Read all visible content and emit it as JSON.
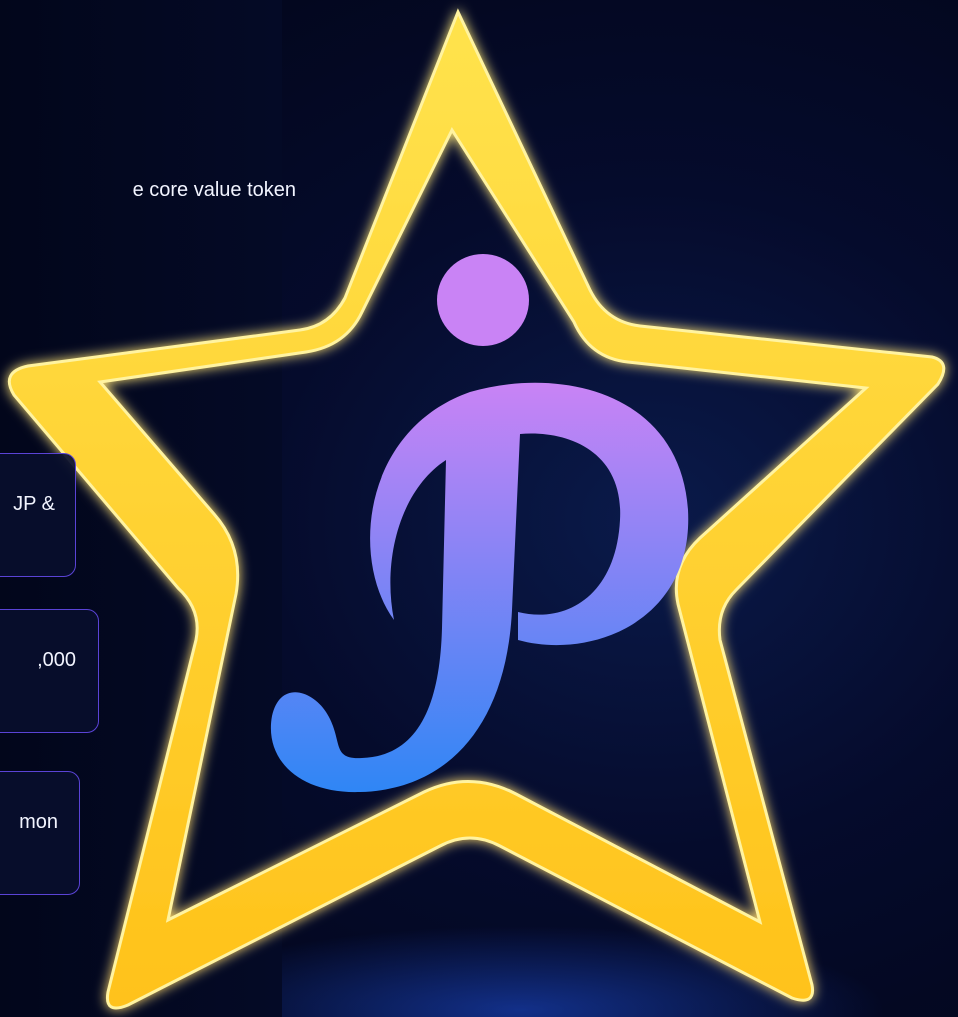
{
  "intro": {
    "text_fragment": "e core value token"
  },
  "feature_cards": [
    {
      "text_fragment": "JP &"
    },
    {
      "text_fragment": ",000"
    },
    {
      "text_fragment": "mon"
    }
  ],
  "logo": {
    "icon": "star-p-logo-icon",
    "letter": "P",
    "star_color": "#ffd21f",
    "star_outline_color": "#ffe86a",
    "p_gradient_top": "#c983f5",
    "p_gradient_bottom": "#2f86f5"
  }
}
